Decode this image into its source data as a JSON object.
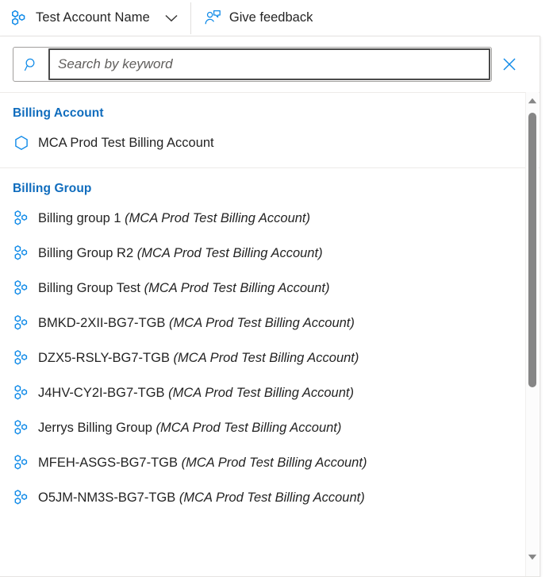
{
  "topbar": {
    "account_icon": "billing-group-hexagons-icon",
    "account_name": "Test Account Name",
    "chevron_icon": "chevron-down-icon",
    "feedback_icon": "person-feedback-icon",
    "feedback_label": "Give feedback"
  },
  "search": {
    "search_icon": "search-icon",
    "placeholder": "Search by keyword",
    "value": "",
    "clear_icon": "close-icon"
  },
  "results": {
    "groups": [
      {
        "header": "Billing Account",
        "items": [
          {
            "icon": "hexagon-icon",
            "name": "MCA Prod Test Billing Account",
            "parent": ""
          }
        ]
      },
      {
        "header": "Billing Group",
        "items": [
          {
            "icon": "billing-group-hexagons-icon",
            "name": "Billing group 1",
            "parent": "(MCA Prod Test Billing Account)"
          },
          {
            "icon": "billing-group-hexagons-icon",
            "name": "Billing Group R2",
            "parent": "(MCA Prod Test Billing Account)"
          },
          {
            "icon": "billing-group-hexagons-icon",
            "name": "Billing Group Test",
            "parent": "(MCA Prod Test Billing Account)"
          },
          {
            "icon": "billing-group-hexagons-icon",
            "name": "BMKD-2XII-BG7-TGB",
            "parent": "(MCA Prod Test Billing Account)"
          },
          {
            "icon": "billing-group-hexagons-icon",
            "name": "DZX5-RSLY-BG7-TGB",
            "parent": "(MCA Prod Test Billing Account)"
          },
          {
            "icon": "billing-group-hexagons-icon",
            "name": "J4HV-CY2I-BG7-TGB",
            "parent": "(MCA Prod Test Billing Account)"
          },
          {
            "icon": "billing-group-hexagons-icon",
            "name": "Jerrys Billing Group",
            "parent": "(MCA Prod Test Billing Account)"
          },
          {
            "icon": "billing-group-hexagons-icon",
            "name": "MFEH-ASGS-BG7-TGB",
            "parent": "(MCA Prod Test Billing Account)"
          },
          {
            "icon": "billing-group-hexagons-icon",
            "name": "O5JM-NM3S-BG7-TGB",
            "parent": "(MCA Prod Test Billing Account)"
          }
        ]
      }
    ]
  },
  "scrollbar": {
    "up_arrow_icon": "caret-up-icon",
    "down_arrow_icon": "caret-down-icon",
    "thumb_name": "scrollbar-thumb"
  },
  "colors": {
    "accent": "#0f6cbd",
    "icon_blue": "#0078d4",
    "text": "#242424",
    "divider": "#edebe9",
    "scroll_thumb": "#868686"
  }
}
